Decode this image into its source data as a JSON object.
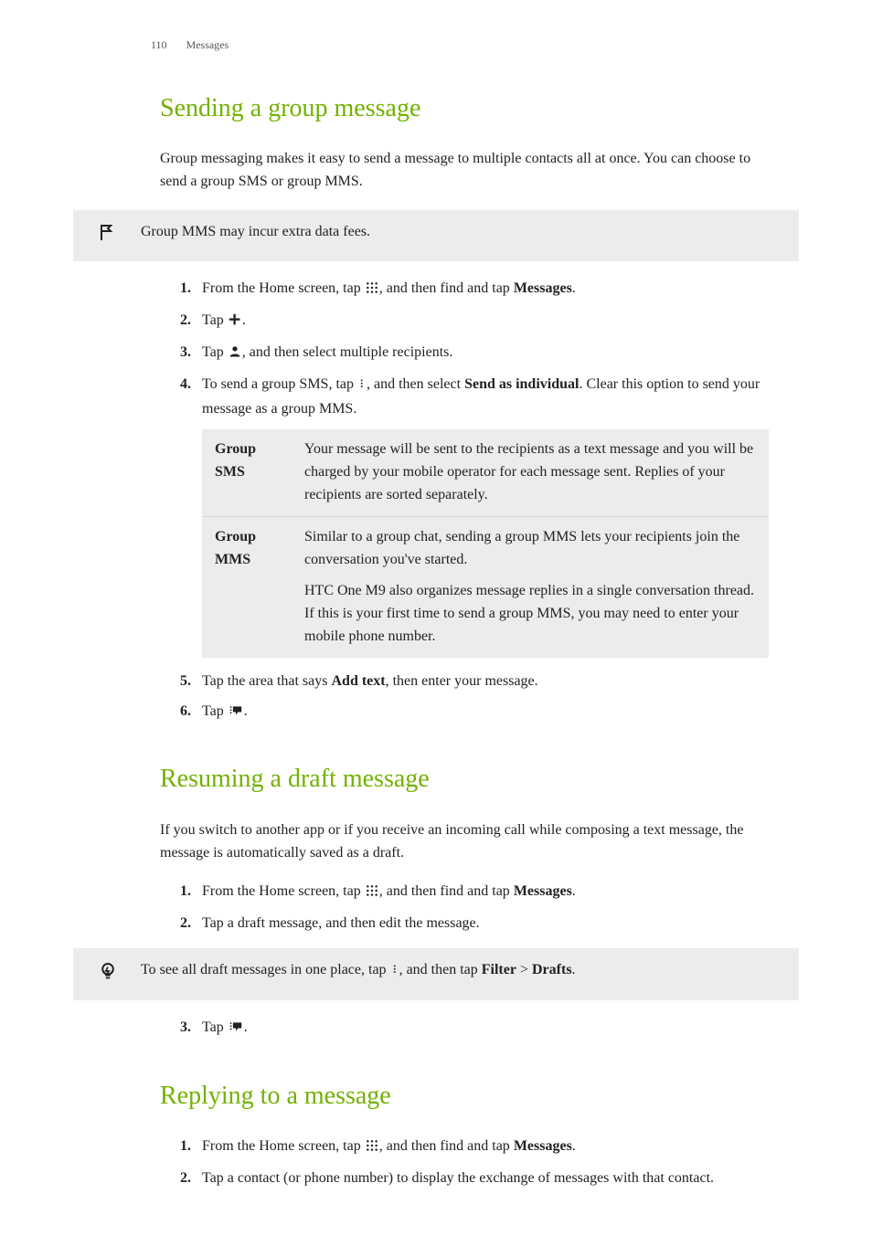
{
  "header": {
    "page_number": "110",
    "section": "Messages"
  },
  "s1": {
    "title": "Sending a group message",
    "intro": "Group messaging makes it easy to send a message to multiple contacts all at once. You can choose to send a group SMS or group MMS.",
    "note": "Group MMS may incur extra data fees.",
    "step1_a": "From the Home screen, tap ",
    "step1_b": ", and then find and tap ",
    "step1_app": "Messages",
    "step1_c": ".",
    "step2_a": "Tap ",
    "step2_b": ".",
    "step3_a": "Tap ",
    "step3_b": ", and then select multiple recipients.",
    "step4_a": "To send a group SMS, tap ",
    "step4_b": ", and then select ",
    "step4_bold": "Send as individual",
    "step4_c": ". Clear this option to send your message as a group MMS.",
    "table": {
      "r1k": "Group SMS",
      "r1v": "Your message will be sent to the recipients as a text message and you will be charged by your mobile operator for each message sent. Replies of your recipients are sorted separately.",
      "r2k": "Group MMS",
      "r2v1": "Similar to a group chat, sending a group MMS lets your recipients join the conversation you've started.",
      "r2v2": "HTC One M9 also organizes message replies in a single conversation thread. If this is your first time to send a group MMS, you may need to enter your mobile phone number."
    },
    "step5_a": "Tap the area that says ",
    "step5_bold": "Add text",
    "step5_b": ", then enter your message.",
    "step6_a": "Tap ",
    "step6_b": "."
  },
  "s2": {
    "title": "Resuming a draft message",
    "intro": "If you switch to another app or if you receive an incoming call while composing a text message, the message is automatically saved as a draft.",
    "step1_a": "From the Home screen, tap ",
    "step1_b": ", and then find and tap ",
    "step1_app": "Messages",
    "step1_c": ".",
    "step2": "Tap a draft message, and then edit the message.",
    "tip_a": "To see all draft messages in one place, tap ",
    "tip_b": ", and then tap ",
    "tip_bold1": "Filter",
    "tip_sep": " > ",
    "tip_bold2": "Drafts",
    "tip_c": ".",
    "step3_a": "Tap ",
    "step3_b": "."
  },
  "s3": {
    "title": "Replying to a message",
    "step1_a": "From the Home screen, tap ",
    "step1_b": ", and then find and tap ",
    "step1_app": "Messages",
    "step1_c": ".",
    "step2": "Tap a contact (or phone number) to display the exchange of messages with that contact."
  }
}
